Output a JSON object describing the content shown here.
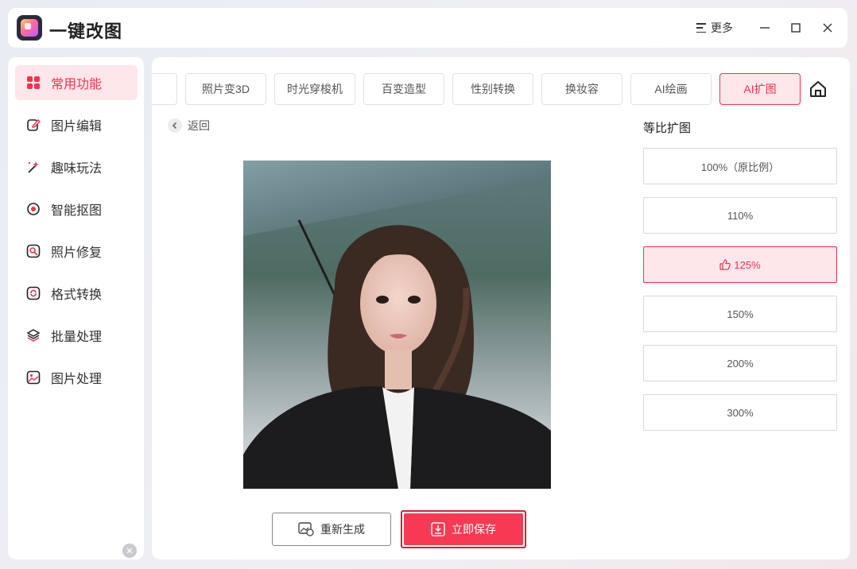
{
  "app": {
    "title": "一键改图",
    "more_label": "更多"
  },
  "sidebar": {
    "items": [
      {
        "label": "常用功能",
        "icon": "grid-icon",
        "active": true
      },
      {
        "label": "图片编辑",
        "icon": "edit-icon"
      },
      {
        "label": "趣味玩法",
        "icon": "magic-wand-icon"
      },
      {
        "label": "智能抠图",
        "icon": "target-icon"
      },
      {
        "label": "照片修复",
        "icon": "repair-icon"
      },
      {
        "label": "格式转换",
        "icon": "convert-icon"
      },
      {
        "label": "批量处理",
        "icon": "layers-icon"
      },
      {
        "label": "图片处理",
        "icon": "image-icon"
      }
    ]
  },
  "tabs": [
    {
      "label": ""
    },
    {
      "label": "照片变3D"
    },
    {
      "label": "时光穿梭机"
    },
    {
      "label": "百变造型"
    },
    {
      "label": "性别转换"
    },
    {
      "label": "换妆容"
    },
    {
      "label": "AI绘画"
    },
    {
      "label": "AI扩图",
      "active": true
    }
  ],
  "main": {
    "back_label": "返回",
    "regenerate_label": "重新生成",
    "save_label": "立即保存"
  },
  "ratio": {
    "title": "等比扩图",
    "options": [
      {
        "label": "100%（原比例）"
      },
      {
        "label": "110%"
      },
      {
        "label": "125%",
        "active": true,
        "icon": "thumbs-up-icon"
      },
      {
        "label": "150%"
      },
      {
        "label": "200%"
      },
      {
        "label": "300%"
      }
    ]
  },
  "colors": {
    "accent": "#f0344e",
    "accent_bg": "#fde7ea",
    "save_fill": "#f63a54"
  }
}
